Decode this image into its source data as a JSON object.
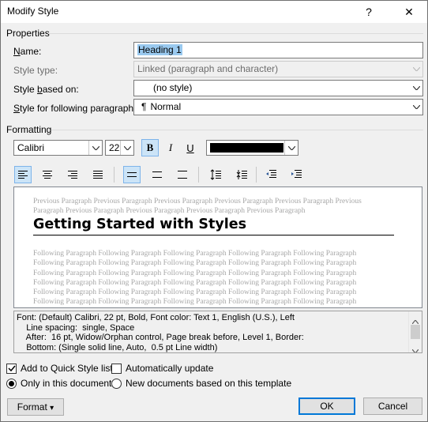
{
  "window": {
    "title": "Modify Style",
    "help_glyph": "?",
    "close_glyph": "✕"
  },
  "properties": {
    "group_label": "Properties",
    "name_label_u": "N",
    "name_label_rest": "ame:",
    "name_value": "Heading 1",
    "style_type_label": "Style type:",
    "style_type_value": "Linked (paragraph and character)",
    "based_on_label_pre": "Style ",
    "based_on_label_u": "b",
    "based_on_label_post": "ased on:",
    "based_on_value": "(no style)",
    "following_label_u": "S",
    "following_label_rest": "tyle for following paragraph:",
    "following_value": "Normal",
    "following_icon_glyph": "¶"
  },
  "formatting": {
    "group_label": "Formatting",
    "font": "Calibri",
    "size": "22",
    "bold_glyph": "B",
    "italic_glyph": "I",
    "underline_glyph": "U",
    "color": "#000000"
  },
  "preview": {
    "previous_line1": "Previous Paragraph Previous Paragraph Previous Paragraph Previous Paragraph Previous Paragraph Previous",
    "previous_line2": "Paragraph Previous Paragraph Previous Paragraph Previous Paragraph Previous Paragraph",
    "heading": "Getting Started with Styles",
    "following_lines": [
      "Following Paragraph Following Paragraph Following Paragraph Following Paragraph Following Paragraph",
      "Following Paragraph Following Paragraph Following Paragraph Following Paragraph Following Paragraph",
      "Following Paragraph Following Paragraph Following Paragraph Following Paragraph Following Paragraph",
      "Following Paragraph Following Paragraph Following Paragraph Following Paragraph Following Paragraph",
      "Following Paragraph Following Paragraph Following Paragraph Following Paragraph Following Paragraph",
      "Following Paragraph Following Paragraph Following Paragraph Following Paragraph Following Paragraph"
    ]
  },
  "description": {
    "lines": [
      "Font: (Default) Calibri, 22 pt, Bold, Font color: Text 1, English (U.S.), Left",
      "    Line spacing:  single, Space",
      "    After:  16 pt, Widow/Orphan control, Page break before, Level 1, Border:",
      "    Bottom: (Single solid line, Auto,  0.5 pt Line width)"
    ]
  },
  "options": {
    "add_quick_style": "Add to Quick Style list",
    "add_quick_style_checked": true,
    "auto_update": "Automatically update",
    "auto_update_checked": false,
    "only_this_doc": "Only in this document",
    "new_docs": "New documents based on this template"
  },
  "buttons": {
    "format": "Format",
    "format_arrow": "▾",
    "ok": "OK",
    "cancel": "Cancel"
  },
  "colors": {
    "accent": "#0078d7",
    "selection": "#99c9ef",
    "pressed": "#cce4f7"
  }
}
